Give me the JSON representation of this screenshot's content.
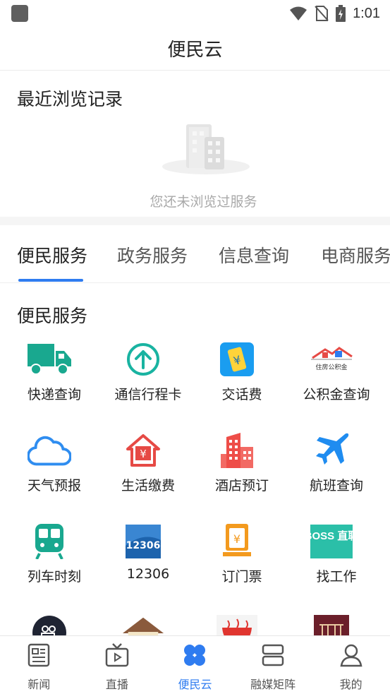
{
  "status_bar": {
    "time": "1:01"
  },
  "header": {
    "title": "便民云"
  },
  "recent": {
    "title": "最近浏览记录",
    "empty_text": "您还未浏览过服务"
  },
  "tabs": [
    {
      "label": "便民服务",
      "active": true
    },
    {
      "label": "政务服务",
      "active": false
    },
    {
      "label": "信息查询",
      "active": false
    },
    {
      "label": "电商服务",
      "active": false
    }
  ],
  "section": {
    "title": "便民服务"
  },
  "services": [
    {
      "label": "快递查询",
      "icon": "delivery-truck-icon"
    },
    {
      "label": "通信行程卡",
      "icon": "arrow-up-circle-icon"
    },
    {
      "label": "交话费",
      "icon": "phone-yuan-icon"
    },
    {
      "label": "公积金查询",
      "icon": "housing-fund-icon",
      "icon_text": "住房公积金"
    },
    {
      "label": "天气预报",
      "icon": "cloud-icon"
    },
    {
      "label": "生活缴费",
      "icon": "house-yuan-icon"
    },
    {
      "label": "酒店预订",
      "icon": "hotel-building-icon"
    },
    {
      "label": "航班查询",
      "icon": "airplane-icon"
    },
    {
      "label": "列车时刻",
      "icon": "train-icon"
    },
    {
      "label": "12306",
      "icon": "12306-logo-icon",
      "icon_text": "12306"
    },
    {
      "label": "订门票",
      "icon": "ticket-hand-icon"
    },
    {
      "label": "找工作",
      "icon": "boss-zhipin-icon",
      "icon_text": "BOSS 直聘"
    }
  ],
  "bottom_nav": [
    {
      "label": "新闻",
      "icon": "news-icon",
      "active": false
    },
    {
      "label": "直播",
      "icon": "tv-live-icon",
      "active": false
    },
    {
      "label": "便民云",
      "icon": "four-petal-icon",
      "active": true
    },
    {
      "label": "融媒矩阵",
      "icon": "stack-icon",
      "active": false
    },
    {
      "label": "我的",
      "icon": "user-icon",
      "active": false
    }
  ],
  "colors": {
    "accent": "#2f7cf0",
    "teal": "#19a88f",
    "red": "#e64a45",
    "orange": "#f39a1e"
  }
}
